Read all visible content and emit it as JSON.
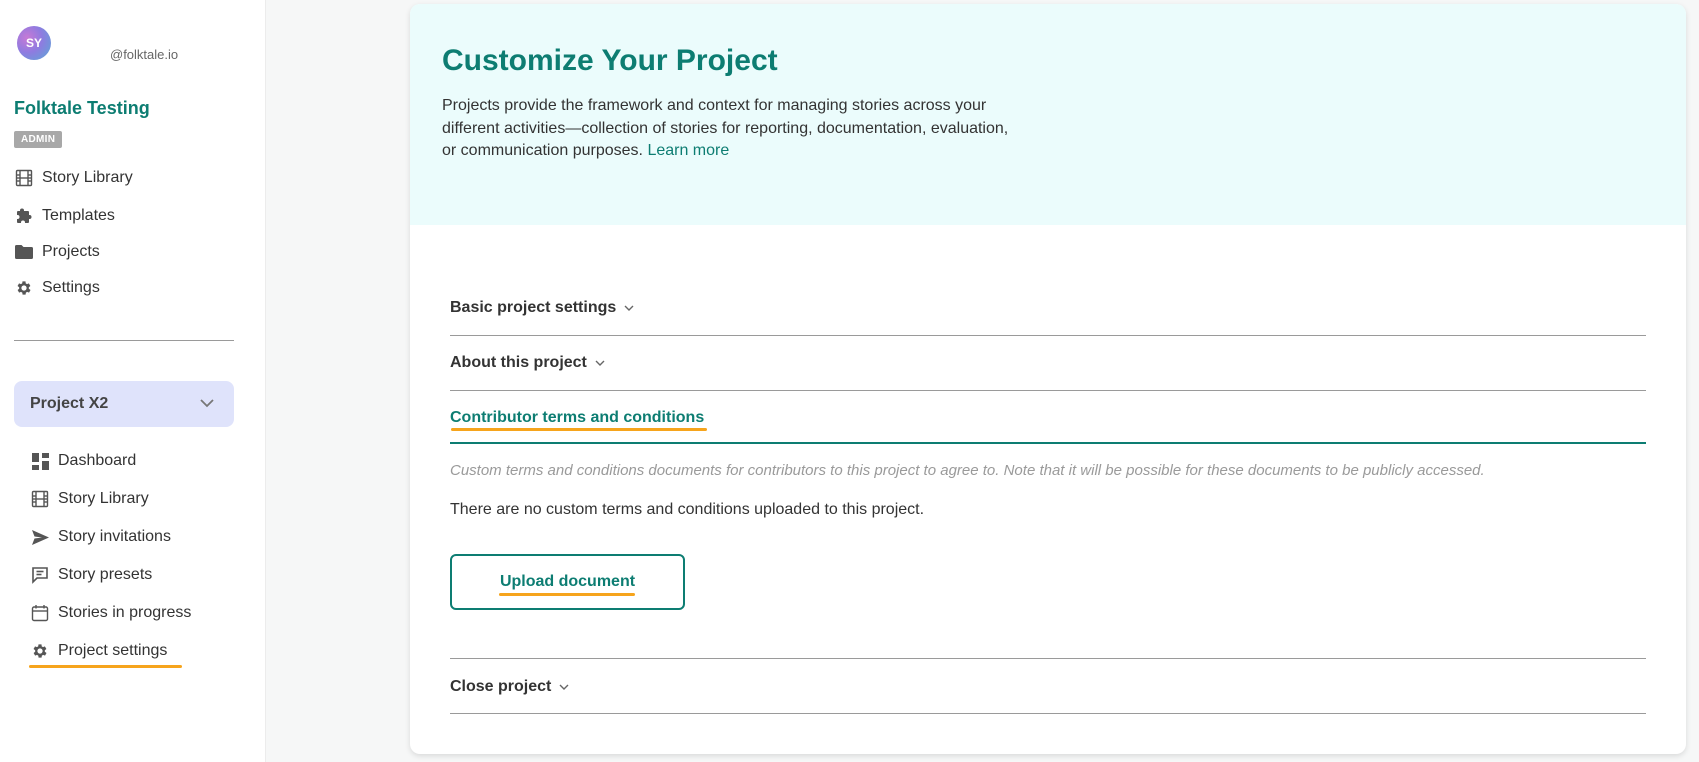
{
  "sidebar": {
    "avatar_initials": "SY",
    "handle": "@folktale.io",
    "org_name": "Folktale Testing",
    "role_badge": "ADMIN",
    "main_nav": [
      {
        "label": "Story Library",
        "icon": "film-icon"
      },
      {
        "label": "Templates",
        "icon": "puzzle-icon"
      },
      {
        "label": "Projects",
        "icon": "folder-icon"
      },
      {
        "label": "Settings",
        "icon": "gear-icon"
      }
    ],
    "project_selector": {
      "value": "Project X2",
      "icon": "chevron-down-icon"
    },
    "project_nav": [
      {
        "label": "Dashboard",
        "icon": "dashboard-icon"
      },
      {
        "label": "Story Library",
        "icon": "film-icon"
      },
      {
        "label": "Story invitations",
        "icon": "send-icon"
      },
      {
        "label": "Story presets",
        "icon": "message-icon"
      },
      {
        "label": "Stories in progress",
        "icon": "calendar-icon"
      },
      {
        "label": "Project settings",
        "icon": "gear-icon",
        "active": true
      }
    ]
  },
  "main": {
    "title": "Customize Your Project",
    "intro": "Projects provide the framework and context for managing stories across your different activities—collection of stories for reporting, documentation, evaluation, or communication purposes.",
    "learn_more": "Learn more",
    "sections": [
      {
        "label": "Basic project settings",
        "expanded": false
      },
      {
        "label": "About this project",
        "expanded": false
      },
      {
        "label": "Contributor terms and conditions",
        "expanded": true
      },
      {
        "label": "Close project",
        "expanded": false
      }
    ],
    "terms": {
      "description": "Custom terms and conditions documents for contributors to this project to agree to. Note that it will be possible for these documents to be publicly accessed.",
      "empty_message": "There are no custom terms and conditions uploaded to this project.",
      "upload_label": "Upload document"
    }
  },
  "colors": {
    "accent": "#0d7d72",
    "highlight": "#f6a41c",
    "hero_bg": "#ebfcfc",
    "project_selector_bg": "#dfe3fb"
  }
}
